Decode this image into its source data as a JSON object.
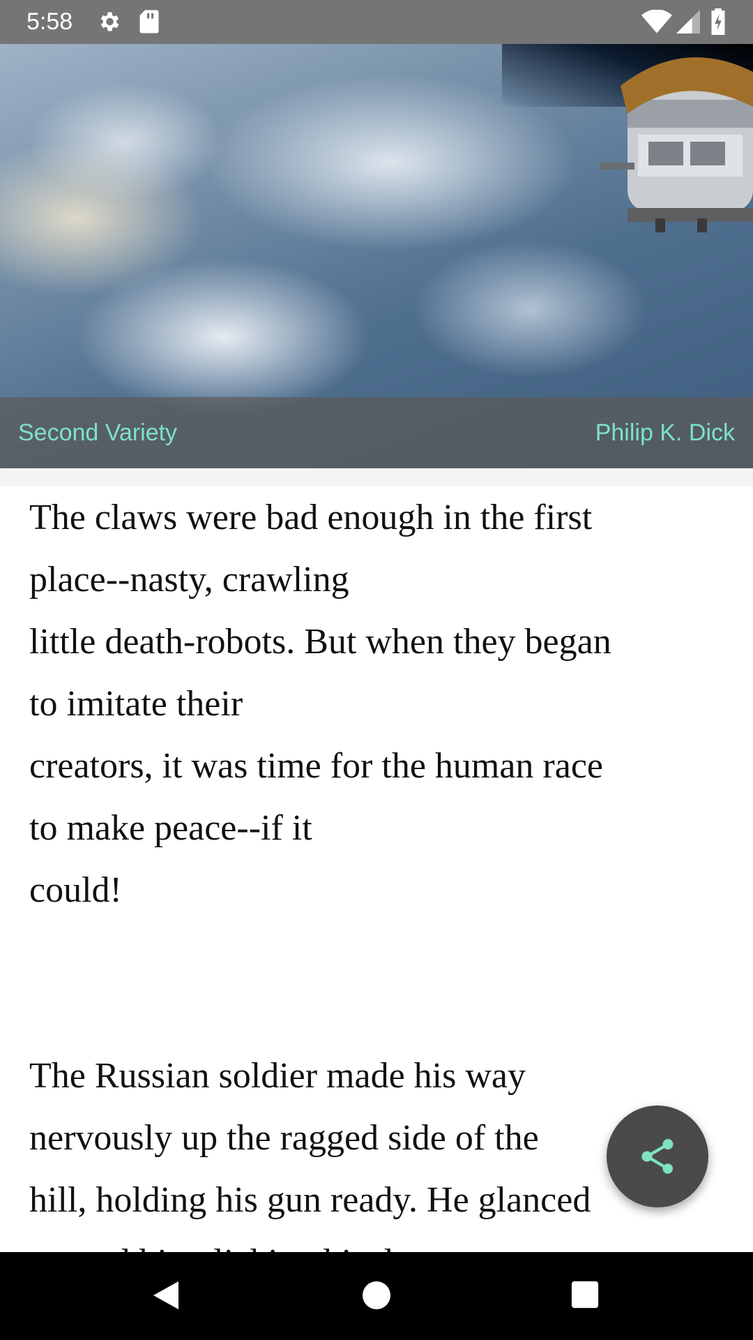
{
  "status_bar": {
    "time": "5:58",
    "left_icons": [
      "gear-icon",
      "sd-card-icon"
    ],
    "right_icons": [
      "wifi-icon",
      "signal-icon",
      "battery-charging-icon"
    ]
  },
  "header": {
    "image": "earth-from-orbit-with-satellite",
    "title": "Second Variety",
    "author": "Philip K. Dick",
    "accent_color": "#7ee2c2"
  },
  "content": {
    "paragraph1": "The claws were bad enough in the first place--nasty, crawling little death-robots. But when they began to imitate their creators, it was time for the human race to make peace--if it could!",
    "paragraph1_lines": [
      "The claws were bad enough in the first",
      "place--nasty, crawling",
      "little death-robots. But when they began",
      "to imitate their",
      "creators, it was time for the human race",
      "to make peace--if it",
      "could!"
    ],
    "paragraph2_lines": [
      "The Russian soldier made his way",
      "nervously up the ragged side of the",
      "hill, holding his gun ready. He glanced",
      "around him, licking his dry"
    ]
  },
  "fab": {
    "icon": "share-icon",
    "icon_color": "#7ee2c2"
  },
  "nav_bar": {
    "buttons": [
      "back-icon",
      "home-icon",
      "recents-icon"
    ]
  }
}
